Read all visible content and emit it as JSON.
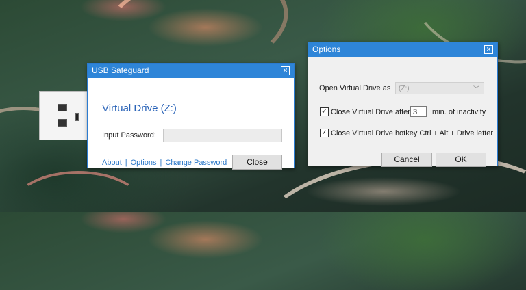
{
  "safeguard": {
    "title": "USB Safeguard",
    "drive_title": "Virtual Drive (Z:)",
    "password_label": "Input Password:",
    "password_value": "",
    "links": {
      "about": "About",
      "separator": "|",
      "options": "Options",
      "change_password": "Change Password"
    },
    "close_label": "Close"
  },
  "options": {
    "title": "Options",
    "open_drive_label": "Open Virtual Drive as",
    "open_drive_value": "(Z:)",
    "close_after_label": "Close Virtual Drive after",
    "close_after_checked": true,
    "minutes_value": "3",
    "inactivity_label": "min. of  inactivity",
    "hotkey_label": "Close Virtual Drive hotkey Ctrl + Alt + Drive letter",
    "hotkey_checked": true,
    "cancel_label": "Cancel",
    "ok_label": "OK"
  },
  "icons": {
    "close": "close-icon",
    "dropdown": "chevron-down-icon",
    "check": "checkmark-icon"
  },
  "colors": {
    "titlebar": "#2e85d8",
    "link": "#2b78c8",
    "drive_title": "#2b64b8"
  }
}
